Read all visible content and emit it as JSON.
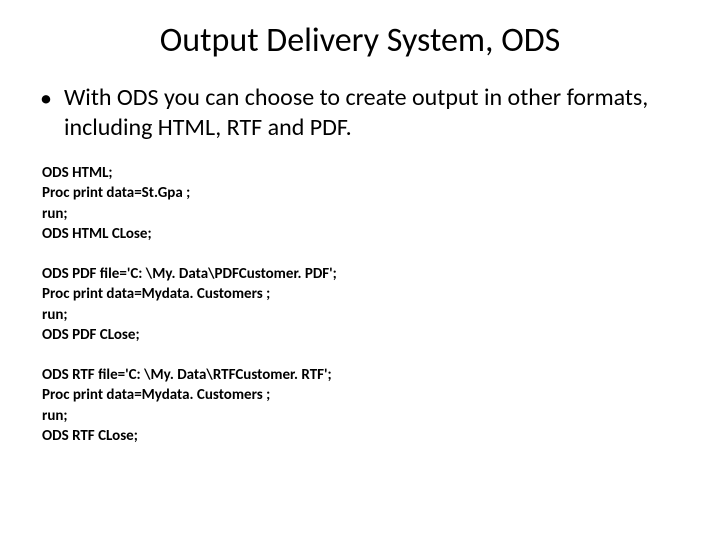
{
  "title": "Output Delivery System, ODS",
  "bullet": "With ODS you can choose to create output in other formats, including HTML, RTF and PDF.",
  "code_blocks": [
    {
      "lines": [
        "ODS HTML;",
        "Proc print data=St.Gpa ;",
        "run;",
        "ODS HTML CLose;"
      ]
    },
    {
      "lines": [
        "ODS PDF file='C: \\My. Data\\PDFCustomer. PDF';",
        "Proc print data=Mydata. Customers ;",
        "run;",
        "ODS PDF CLose;"
      ]
    },
    {
      "lines": [
        "ODS RTF file='C: \\My. Data\\RTFCustomer. RTF';",
        "Proc print data=Mydata. Customers ;",
        "run;",
        "ODS RTF CLose;"
      ]
    }
  ]
}
